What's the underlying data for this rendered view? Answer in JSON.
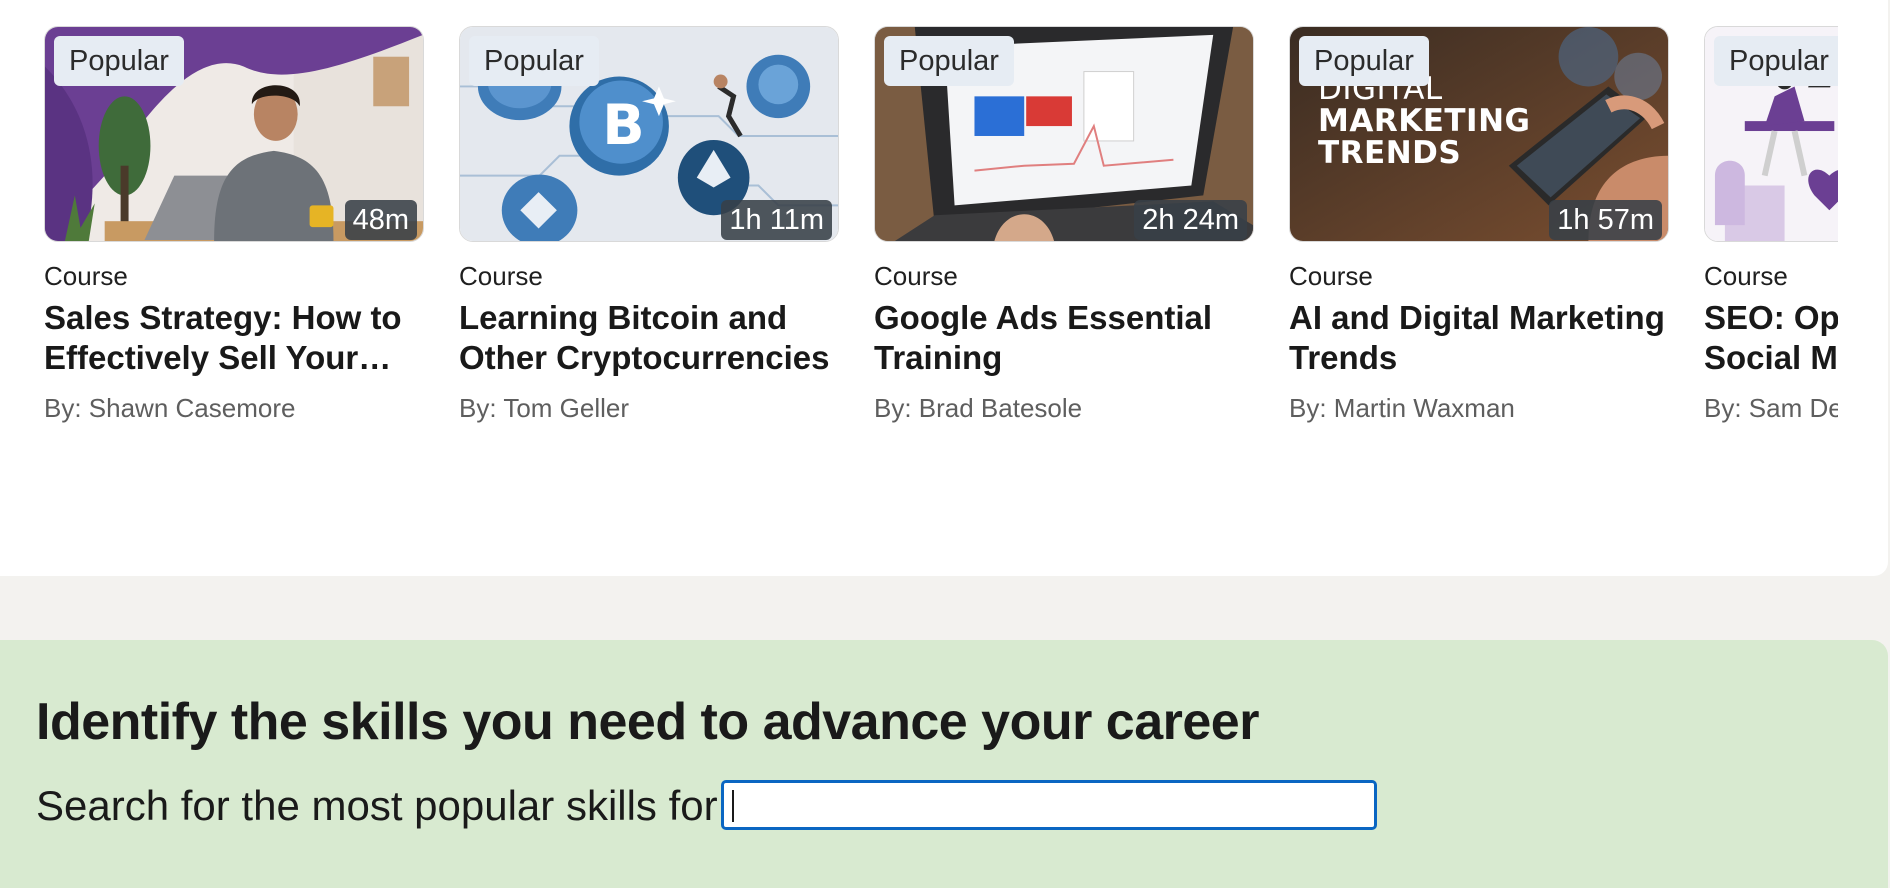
{
  "courses": [
    {
      "badge": "Popular",
      "duration": "48m",
      "type": "Course",
      "title": "Sales Strategy: How to Effectively Sell Your Products and Services",
      "author": "By: Shawn Casemore"
    },
    {
      "badge": "Popular",
      "duration": "1h 11m",
      "type": "Course",
      "title": "Learning Bitcoin and Other Cryptocurrencies",
      "author": "By: Tom Geller"
    },
    {
      "badge": "Popular",
      "duration": "2h 24m",
      "type": "Course",
      "title": "Google Ads Essential Training",
      "author": "By: Brad Batesole"
    },
    {
      "badge": "Popular",
      "duration": "1h 57m",
      "type": "Course",
      "title": "AI and Digital Marketing Trends",
      "author": "By: Martin Waxman",
      "thumb_text": [
        "DIGITAL",
        "MARKETING",
        "TRENDS"
      ]
    },
    {
      "badge": "Popular",
      "duration": "",
      "type": "Course",
      "title": "SEO: Optimizing for Social Media",
      "author": "By: Sam Dey"
    }
  ],
  "thumb_icons": [
    "person-at-laptop-image",
    "crypto-coins-image",
    "laptop-analytics-image",
    "phone-digital-marketing-image",
    "person-with-hearts-image"
  ],
  "skills": {
    "title": "Identify the skills you need to advance your career",
    "prompt": "Search for the most popular skills for a",
    "input_value": "",
    "input_placeholder": ""
  },
  "colors": {
    "skills_bg": "#d8ead0",
    "input_focus": "#0a66c2",
    "page_bg": "#f3f2ef"
  }
}
